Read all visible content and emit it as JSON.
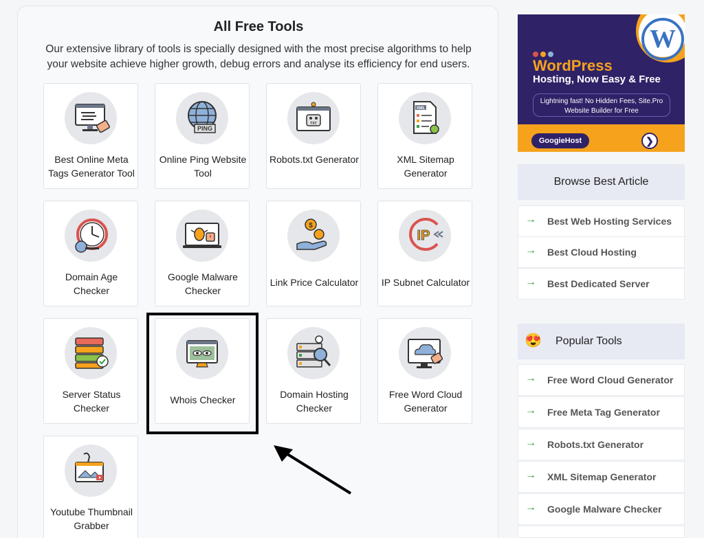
{
  "main": {
    "title": "All Free Tools",
    "description": "Our extensive library of tools is specially designed with the most precise algorithms to help your website achieve higher growth, debug errors and analyse its efficiency for end users."
  },
  "tools": [
    {
      "label": "Best Online Meta Tags Generator Tool",
      "icon": "meta-tags-icon"
    },
    {
      "label": "Online Ping Website Tool",
      "icon": "ping-globe-icon",
      "badge": "PING"
    },
    {
      "label": "Robots.txt Generator",
      "icon": "robot-icon",
      "badge": "TXT"
    },
    {
      "label": "XML Sitemap Generator",
      "icon": "xml-document-icon",
      "badge": "XML"
    },
    {
      "label": "Domain Age Checker",
      "icon": "clock-icon"
    },
    {
      "label": "Google Malware Checker",
      "icon": "malware-bug-icon"
    },
    {
      "label": "Link Price Calculator",
      "icon": "dollar-coins-icon",
      "badge": "$"
    },
    {
      "label": "IP Subnet Calculator",
      "icon": "ip-icon",
      "badge": "IP"
    },
    {
      "label": "Server Status Checker",
      "icon": "server-icon"
    },
    {
      "label": "Whois Checker",
      "icon": "eyes-monitor-icon"
    },
    {
      "label": "Domain Hosting Checker",
      "icon": "hosting-search-icon"
    },
    {
      "label": "Free Word Cloud Generator",
      "icon": "word-cloud-monitor-icon"
    },
    {
      "label": "Youtube Thumbnail Grabber",
      "icon": "thumbnail-icon"
    }
  ],
  "ad": {
    "title": "WordPress",
    "subtitle": "Hosting, Now Easy & Free",
    "tagline": "Lightning fast! No Hidden Fees, Site.Pro Website Builder for Free",
    "brand": "GoogieHost",
    "logo_letter": "W",
    "go_glyph": "❯",
    "colors": {
      "background": "#2f2267",
      "accent": "#f6a21d",
      "logo": "#3873c2"
    }
  },
  "browse": {
    "heading": "Browse Best Article",
    "items": [
      "Best Web Hosting Services",
      "Best Cloud Hosting",
      "Best Dedicated Server"
    ]
  },
  "popular": {
    "heading": "Popular Tools",
    "emoji": "😍",
    "items": [
      "Free Word Cloud Generator",
      "Free Meta Tag Generator",
      "Robots.txt Generator",
      "XML Sitemap Generator",
      "Google Malware Checker"
    ]
  },
  "arrow_glyph": "→",
  "colors": {
    "arrow": "#2e9e3e",
    "sidebar_heading_bg": "#e7e9f3",
    "highlight": "#000000"
  }
}
